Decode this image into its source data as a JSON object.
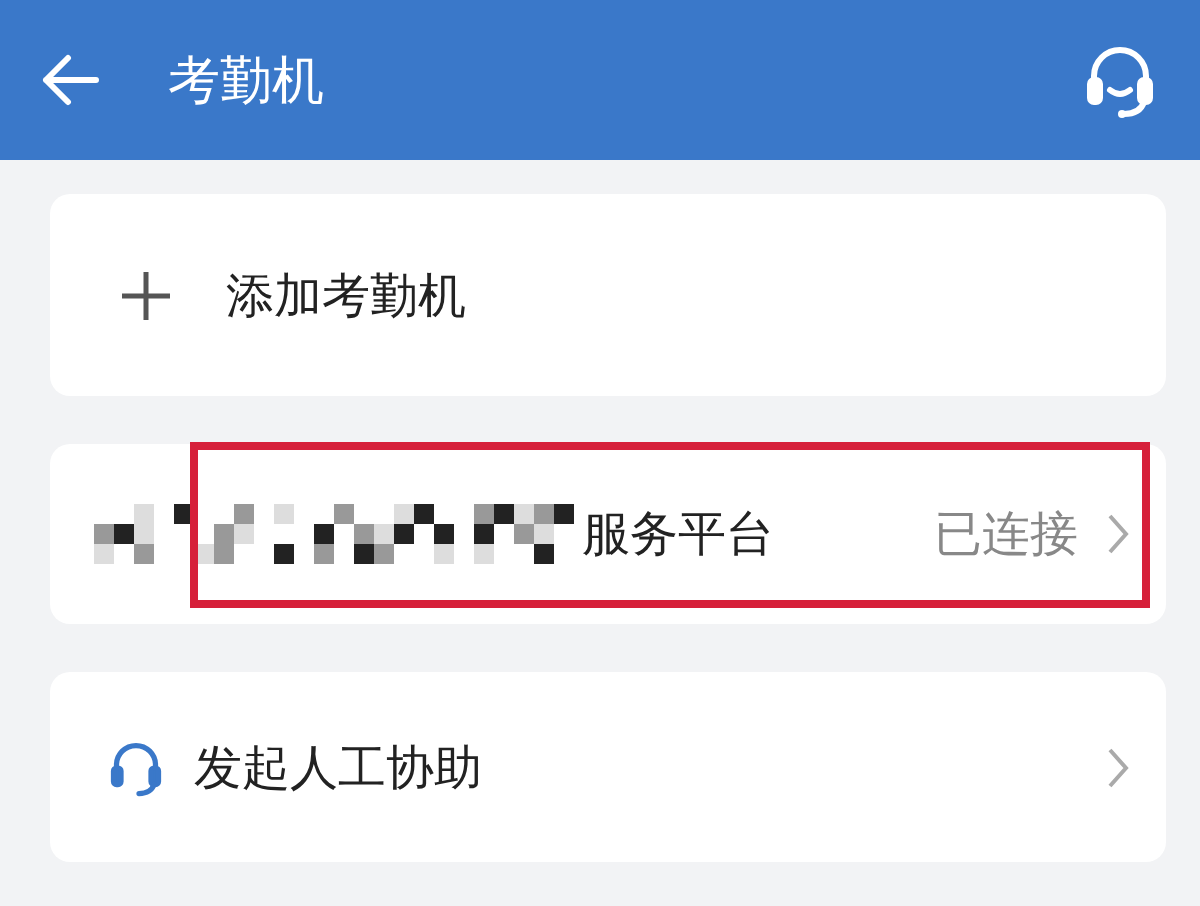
{
  "header": {
    "title": "考勤机"
  },
  "items": [
    {
      "kind": "add",
      "label": "添加考勤机"
    },
    {
      "kind": "device",
      "label": "服务平台",
      "status": "已连接",
      "highlighted": true
    },
    {
      "kind": "assist",
      "label": "发起人工协助"
    }
  ]
}
